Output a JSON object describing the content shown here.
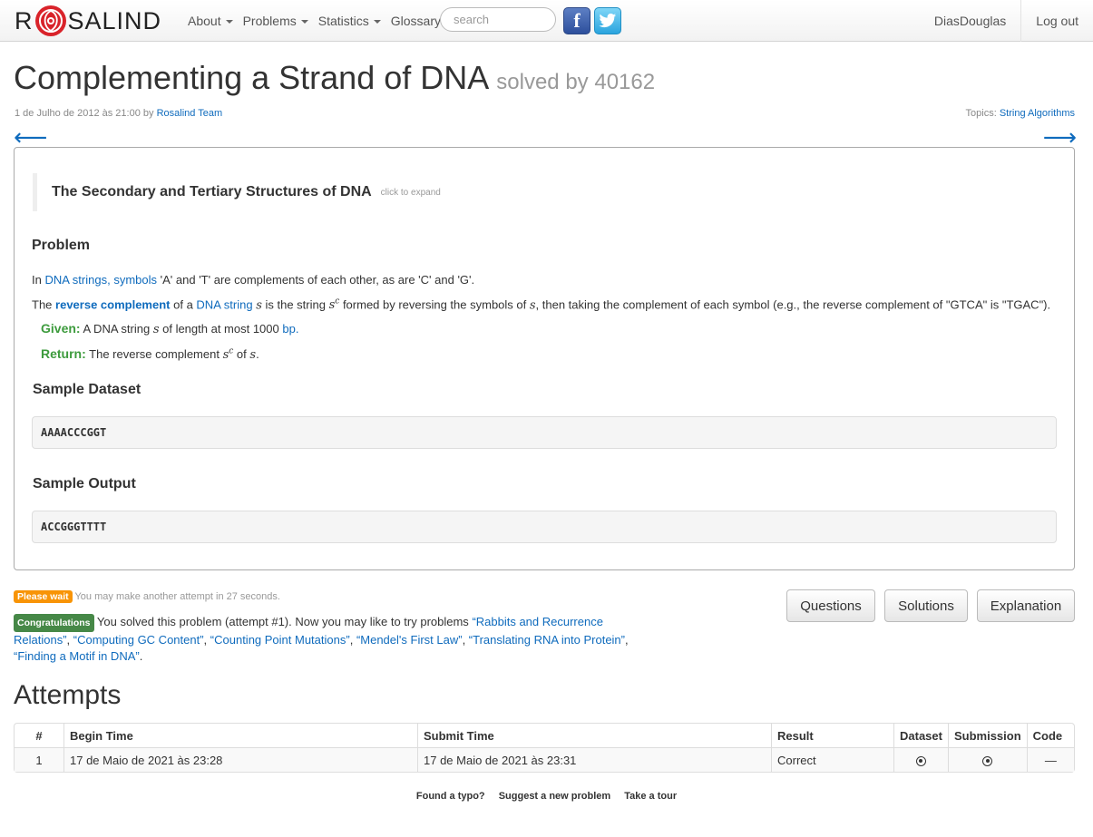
{
  "navbar": {
    "brand_left": "R",
    "brand_right": "SALIND",
    "menu": [
      {
        "label": "About",
        "dropdown": true
      },
      {
        "label": "Problems",
        "dropdown": true
      },
      {
        "label": "Statistics",
        "dropdown": true
      },
      {
        "label": "Glossary",
        "dropdown": false
      }
    ],
    "search_placeholder": "search",
    "facebook_glyph": "f",
    "twitter_glyph": "t",
    "user": "DiasDouglas",
    "logout": "Log out"
  },
  "header": {
    "title": "Complementing a Strand of DNA",
    "solved_by": "solved by 40162",
    "date": "1 de Julho de 2012 às 21:00 by",
    "author": "Rosalind Team",
    "topics_label": "Topics:",
    "topic": "String Algorithms",
    "prev_arrow": "⟵",
    "next_arrow": "⟶"
  },
  "problem": {
    "expand_title": "The Secondary and Tertiary Structures of DNA",
    "expand_hint": "click to expand",
    "heading": "Problem",
    "p1_pre": "In",
    "p1_link1": "DNA strings,",
    "p1_link2": "symbols",
    "p1_post": "'A' and 'T' are complements of each other, as are 'C' and 'G'.",
    "p2_pre": "The",
    "p2_bold_link": "reverse complement",
    "p2_mid1": "of a",
    "p2_link": "DNA string",
    "p2_var_s": "s",
    "p2_mid2": "is the string",
    "p2_sup": "c",
    "p2_mid3": "formed by reversing the symbols of",
    "p2_post": ", then taking the complement of each symbol (e.g., the reverse complement of \"GTCA\" is \"TGAC\").",
    "given_label": "Given:",
    "given_pre": "A DNA string",
    "given_post": "of length at most 1000",
    "given_link": "bp.",
    "return_label": "Return:",
    "return_pre": "The reverse complement",
    "return_post": "of",
    "return_end": ".",
    "sample_dataset_heading": "Sample Dataset",
    "sample_dataset": "AAAACCCGGT",
    "sample_output_heading": "Sample Output",
    "sample_output": "ACCGGGTTTT"
  },
  "status": {
    "wait_label": "Please wait",
    "wait_text": "You may make another attempt in 27 seconds.",
    "congrats_label": "Congratulations",
    "congrats_text": "You solved this problem (attempt #1). Now you may like to try problems",
    "suggestions": [
      "“Rabbits and Recurrence Relations”",
      "“Computing GC Content”",
      "“Counting Point Mutations”",
      "“Mendel's First Law”",
      "“Translating RNA into Protein”",
      "“Finding a Motif in DNA”"
    ],
    "end": "."
  },
  "buttons": {
    "questions": "Questions",
    "solutions": "Solutions",
    "explanation": "Explanation"
  },
  "attempts": {
    "heading": "Attempts",
    "columns": [
      "#",
      "Begin Time",
      "Submit Time",
      "Result",
      "Dataset",
      "Submission",
      "Code"
    ],
    "rows": [
      {
        "num": "1",
        "begin": "17 de Maio de 2021 às 23:28",
        "submit": "17 de Maio de 2021 às 23:31",
        "result": "Correct",
        "code": "—"
      }
    ]
  },
  "footer": {
    "typo": "Found a typo?",
    "suggest": "Suggest a new problem",
    "tour": "Take a tour"
  }
}
